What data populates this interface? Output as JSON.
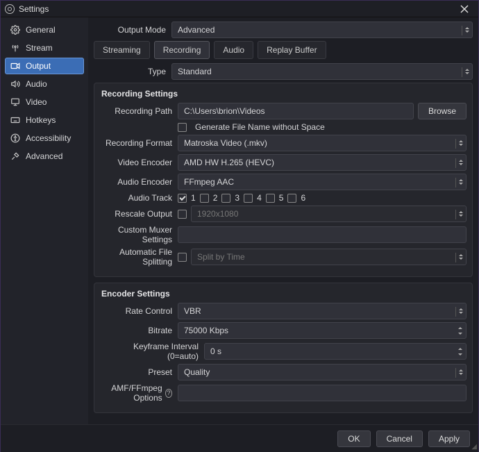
{
  "window": {
    "title": "Settings"
  },
  "sidebar": {
    "items": [
      {
        "label": "General"
      },
      {
        "label": "Stream"
      },
      {
        "label": "Output"
      },
      {
        "label": "Audio"
      },
      {
        "label": "Video"
      },
      {
        "label": "Hotkeys"
      },
      {
        "label": "Accessibility"
      },
      {
        "label": "Advanced"
      }
    ]
  },
  "output_mode": {
    "label": "Output Mode",
    "value": "Advanced"
  },
  "tabs": {
    "streaming": "Streaming",
    "recording": "Recording",
    "audio": "Audio",
    "replay_buffer": "Replay Buffer"
  },
  "type_row": {
    "label": "Type",
    "value": "Standard"
  },
  "recording": {
    "section_title": "Recording Settings",
    "path_label": "Recording Path",
    "path_value": "C:\\Users\\brion\\Videos",
    "browse": "Browse",
    "gen_no_space": "Generate File Name without Space",
    "format_label": "Recording Format",
    "format_value": "Matroska Video (.mkv)",
    "venc_label": "Video Encoder",
    "venc_value": "AMD HW H.265 (HEVC)",
    "aenc_label": "Audio Encoder",
    "aenc_value": "FFmpeg AAC",
    "track_label": "Audio Track",
    "tracks": [
      "1",
      "2",
      "3",
      "4",
      "5",
      "6"
    ],
    "rescale_label": "Rescale Output",
    "rescale_value": "1920x1080",
    "muxer_label": "Custom Muxer Settings",
    "split_label": "Automatic File Splitting",
    "split_value": "Split by Time"
  },
  "encoder": {
    "section_title": "Encoder Settings",
    "rate_label": "Rate Control",
    "rate_value": "VBR",
    "bitrate_label": "Bitrate",
    "bitrate_value": "75000 Kbps",
    "keyframe_label": "Keyframe Interval (0=auto)",
    "keyframe_value": "0 s",
    "preset_label": "Preset",
    "preset_value": "Quality",
    "amf_label": "AMF/FFmpeg Options"
  },
  "footer": {
    "ok": "OK",
    "cancel": "Cancel",
    "apply": "Apply"
  }
}
